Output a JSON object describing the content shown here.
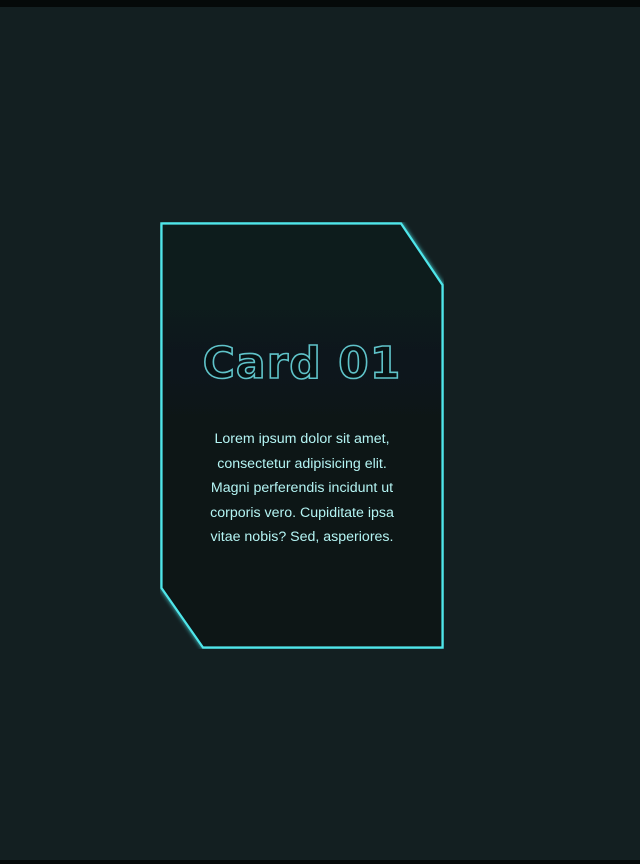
{
  "card": {
    "title": "Card 01",
    "body": "Lorem ipsum dolor sit amet, consectetur adipisicing elit. Magni perferendis incidunt ut corporis vero. Cupiditate ipsa vitae nobis? Sed, asperiores."
  },
  "colors": {
    "background": "#131f21",
    "card_fill": "#0b1516",
    "border_glow": "#4fe6ea",
    "text": "#b4f4f3",
    "title_stroke": "#5fc3c9"
  }
}
